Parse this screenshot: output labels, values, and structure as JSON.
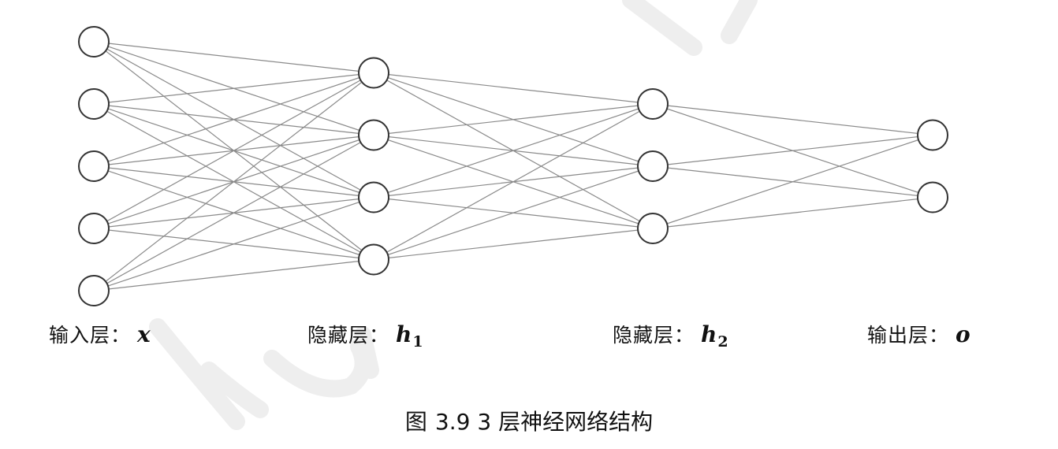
{
  "diagram": {
    "layers": [
      {
        "id": "input",
        "label": "输入层：",
        "variable": "x",
        "subscript": "",
        "neurons": 5
      },
      {
        "id": "h1",
        "label": "隐藏层：",
        "variable": "h",
        "subscript": "1",
        "neurons": 4
      },
      {
        "id": "h2",
        "label": "隐藏层：",
        "variable": "h",
        "subscript": "2",
        "neurons": 3
      },
      {
        "id": "output",
        "label": "输出层：",
        "variable": "o",
        "subscript": "",
        "neurons": 2
      }
    ],
    "connectivity": "fully-connected",
    "colors": {
      "edge": "#8a8a8a",
      "node_stroke": "#333333",
      "node_fill": "#ffffff",
      "text": "#111111",
      "watermark": "#eeeeee"
    }
  },
  "caption": {
    "prefix": "图",
    "text": "3.9 3 层神经网络结构"
  }
}
